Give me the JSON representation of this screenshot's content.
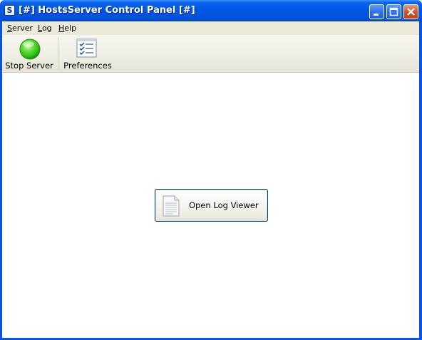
{
  "window": {
    "title": "[#] HostsServer Control Panel [#]",
    "app_icon_letter": "S",
    "accent_color": "#0058e6"
  },
  "menubar": {
    "items": [
      {
        "label_underlined": "S",
        "label_rest": "erver"
      },
      {
        "label_underlined": "L",
        "label_rest": "og"
      },
      {
        "label_underlined": "H",
        "label_rest": "elp"
      }
    ]
  },
  "toolbar": {
    "stop_server": {
      "label": "Stop Server",
      "icon": "green-status-orb-icon",
      "status_color": "#33cc22"
    },
    "preferences": {
      "label": "Preferences",
      "icon": "checklist-icon"
    }
  },
  "main": {
    "open_log_viewer": {
      "label": "Open Log Viewer",
      "icon": "document-icon"
    }
  }
}
